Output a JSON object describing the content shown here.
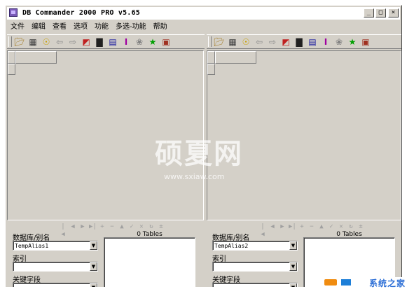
{
  "window": {
    "title": "DB Commander 2000 PRO v5.65"
  },
  "window_buttons": {
    "minimize": "_",
    "maximize": "□",
    "close": "×"
  },
  "menu": [
    "文件",
    "编辑",
    "查看",
    "选项",
    "功能",
    "多选-功能",
    "帮助"
  ],
  "toolbar_icons": [
    "open-icon",
    "grid-icon",
    "find-icon",
    "back-icon",
    "forward-icon",
    "table-icon",
    "trash-icon",
    "database-icon",
    "index-icon",
    "key-icon",
    "run-icon",
    "exit-icon"
  ],
  "left": {
    "db_label": "数据库/别名",
    "db_value": "TempAlias1",
    "index_label": "索引",
    "index_value": "",
    "key_label": "关键字段",
    "key_value": "",
    "tables_label": "0 Tables"
  },
  "right": {
    "db_label": "数据库/别名",
    "db_value": "TempAlias2",
    "index_label": "索引",
    "index_value": "",
    "key_label": "关键字段",
    "key_value": "",
    "tables_label": "0 Tables"
  },
  "nav_buttons": [
    "|◀",
    "◀",
    "▶",
    "▶|",
    "+",
    "−",
    "▲",
    "✓",
    "✕",
    "↻",
    "±"
  ],
  "watermark": {
    "main": "硕夏网",
    "sub": "www.sxiaw.com"
  },
  "corner_logo": {
    "text": "系统之家"
  },
  "colors": {
    "face": "#d4d0c8",
    "highlight": "#ffffff",
    "shadow": "#808080"
  }
}
